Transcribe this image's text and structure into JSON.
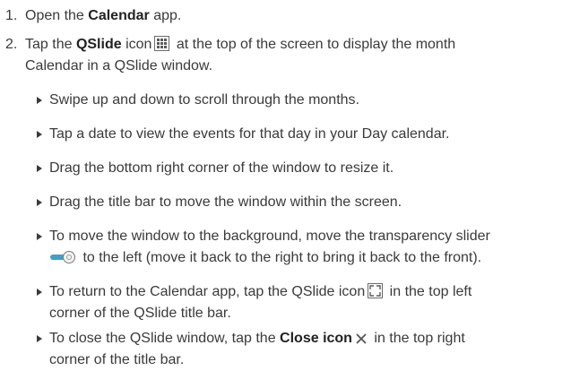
{
  "steps": [
    {
      "num": "1.",
      "a": "Open the ",
      "b": "Calendar",
      "c": " app."
    },
    {
      "num": "2.",
      "a": "Tap the ",
      "b": "QSlide",
      "c": " icon",
      "d": " at the top of the screen to display the month",
      "cont": "Calendar in a QSlide window."
    }
  ],
  "bullets": {
    "b1": "Swipe up and down to scroll through the months.",
    "b2": "Tap a date to view the events for that day in your Day calendar.",
    "b3": "Drag the bottom right corner of the window to resize it.",
    "b4": "Drag the title bar to move the window within the screen.",
    "b5": {
      "line1": "To move the window to the background, move the transparency slider",
      "line2": " to the left (move it back to the right to bring it back to the front)."
    },
    "b6": {
      "line1a": "To return to the Calendar app, tap the QSlide icon",
      "line1b": " in the top left",
      "line2": "corner of the QSlide title bar."
    },
    "b7": {
      "line1a": "To close the QSlide window, tap the ",
      "bold": "Close icon",
      "line1b": " in the top right",
      "line2": "corner of the title bar."
    }
  },
  "icons": {
    "qslide_grid": "qslide-grid-icon",
    "slider": "transparency-slider-icon",
    "qslide_return": "qslide-return-icon",
    "close": "close-icon"
  }
}
